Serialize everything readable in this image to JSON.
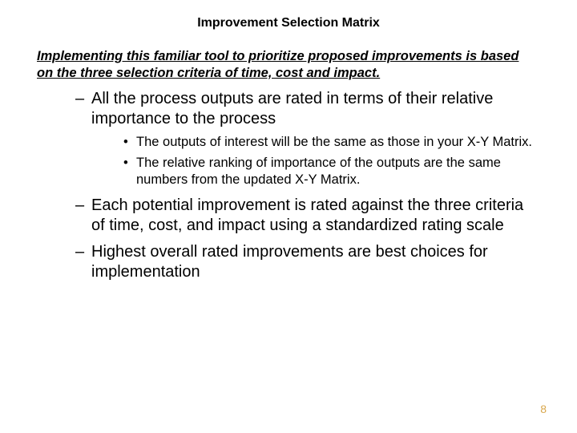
{
  "title": "Improvement Selection Matrix",
  "intro": "Implementing this familiar tool to prioritize proposed improvements is based on the three selection criteria of time, cost and impact.",
  "bullets": {
    "b1": "All the process outputs are rated in terms of their relative importance to the process",
    "b1_sub": {
      "s1": "The outputs of interest will be the same as those in your X-Y Matrix.",
      "s2": "The relative ranking of importance of the outputs are the same numbers from the updated X-Y Matrix."
    },
    "b2": "Each potential improvement is rated against the three criteria  of time, cost, and impact using a standardized rating scale",
    "b3": "Highest overall rated improvements are best choices for implementation"
  },
  "page_number": "8"
}
